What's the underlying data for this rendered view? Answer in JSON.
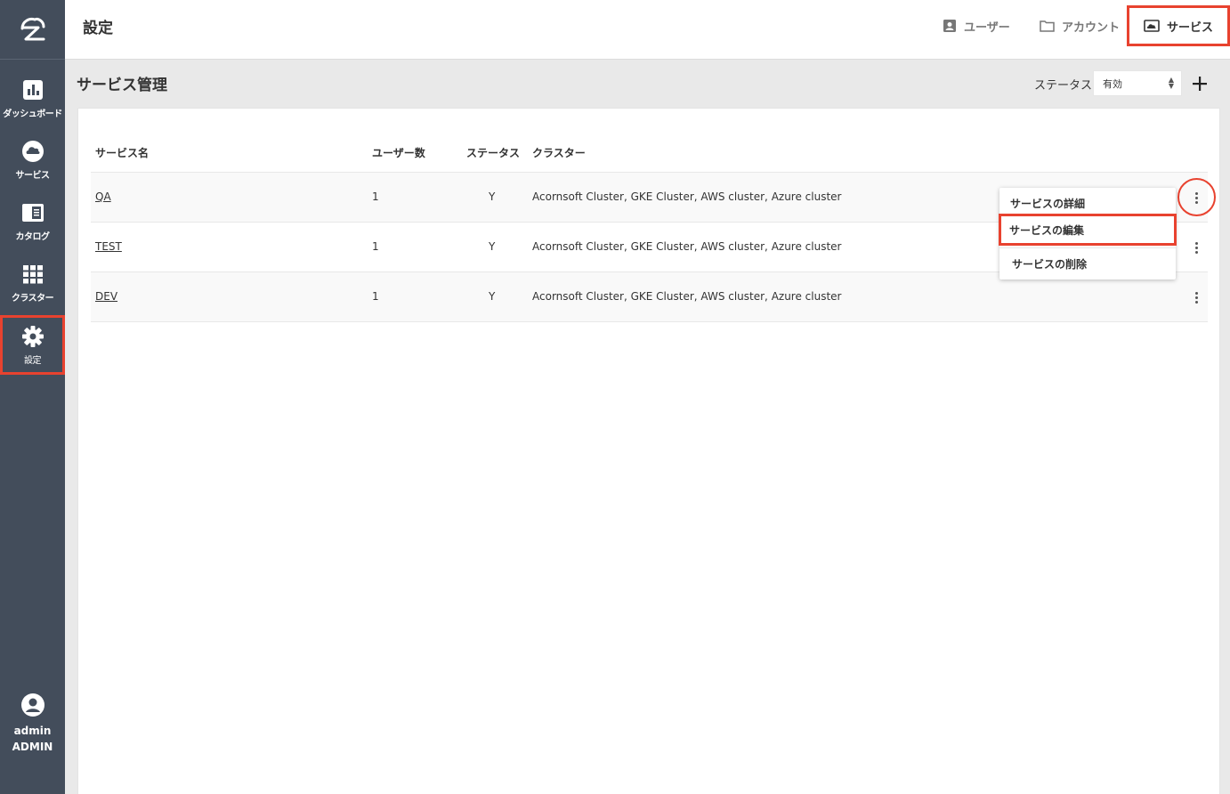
{
  "sidebar": {
    "items": [
      {
        "label": "ダッシュボード",
        "icon": "dashboard-chart-icon"
      },
      {
        "label": "サービス",
        "icon": "cloud-icon"
      },
      {
        "label": "カタログ",
        "icon": "catalog-book-icon"
      },
      {
        "label": "クラスター",
        "icon": "grid-icon"
      },
      {
        "label": "設定",
        "icon": "gear-icon"
      }
    ],
    "user": {
      "name": "admin",
      "role": "ADMIN"
    }
  },
  "header": {
    "title": "設定",
    "tabs": [
      {
        "label": "ユーザー",
        "icon": "user-card-icon"
      },
      {
        "label": "アカウント",
        "icon": "folder-icon"
      },
      {
        "label": "サービス",
        "icon": "cloud-box-icon"
      }
    ]
  },
  "section": {
    "title": "サービス管理",
    "status_label": "ステータス：",
    "status_value": "有効"
  },
  "table": {
    "headers": [
      "サービス名",
      "ユーザー数",
      "ステータス",
      "クラスター"
    ],
    "rows": [
      {
        "name": "QA",
        "users": "1",
        "status": "Y",
        "clusters": "Acornsoft Cluster, GKE Cluster, AWS cluster, Azure cluster"
      },
      {
        "name": "TEST",
        "users": "1",
        "status": "Y",
        "clusters": "Acornsoft Cluster, GKE Cluster, AWS cluster, Azure cluster"
      },
      {
        "name": "DEV",
        "users": "1",
        "status": "Y",
        "clusters": "Acornsoft Cluster, GKE Cluster, AWS cluster, Azure cluster"
      }
    ]
  },
  "menu": {
    "items": [
      "サービスの詳細",
      "サービスの編集",
      "サービスの削除"
    ]
  },
  "colors": {
    "sidebar": "#434d5b",
    "highlight": "#e8422f"
  }
}
